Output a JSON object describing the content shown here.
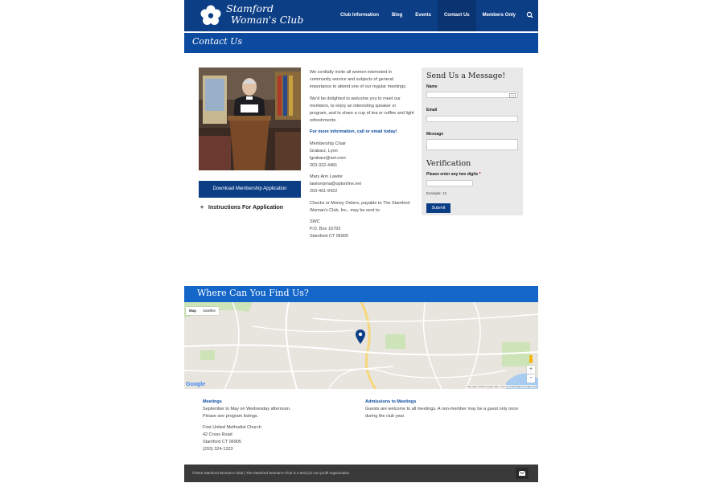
{
  "site": {
    "logo_text_line1": "Stamford",
    "logo_text_line2": "Woman's Club"
  },
  "nav": {
    "items": [
      "Club Information",
      "Blog",
      "Events",
      "Contact Us",
      "Members Only"
    ],
    "active": "Contact Us",
    "search_icon": "search-icon"
  },
  "page_title": "Contact Us",
  "left": {
    "download_button": "Download Membership Application",
    "instructions_label": "Instructions For Application"
  },
  "middle": {
    "intro": "We cordially invite all women interested in community service and subjects of general importance to attend one of our regular meetings.",
    "welcome": "We'd be delighted to welcome you to meet our members, to enjoy an interesting speaker or program, and to share a cup of tea or coffee and light refreshments.",
    "highlight": "For more information, call or email today!",
    "contact1_title": "Membership Chair",
    "contact1_name": "Grabarz, Lynn",
    "contact1_email": "lgrabarz@aol.com",
    "contact1_phone": "203-322-4481",
    "contact2_name": "Mary Ann Lawlor",
    "contact2_email": "lawlorrpma@optonline.net",
    "contact2_phone": "203-461-9422",
    "checks": "Checks or Money Orders, payable to The Stamford Woman's Club, Inc., may be sent to:",
    "addr1": "SWC",
    "addr2": "P.O. Box 16793",
    "addr3": "Stamford CT 06905"
  },
  "form": {
    "title": "Send Us a Message!",
    "name_label": "Name",
    "email_label": "Email",
    "message_label": "Message",
    "verification_title": "Verification",
    "verification_label": "Please enter any two digits",
    "required_mark": "*",
    "example": "Example: 12",
    "submit": "Submit"
  },
  "map_section": {
    "title": "Where Can You Find Us?",
    "map_tab": "Map",
    "satellite_tab": "Satellite",
    "google": "Google",
    "footer_text": "Map data ©2016 Google   500 m   Terms of Use   Report a map error",
    "zoom_in": "+",
    "zoom_out": "−"
  },
  "meetings": {
    "title": "Meetings",
    "line1": "September to May on Wednesday afternoon.",
    "line2": "Please see program listings.",
    "venue1": "First United Methodist Church",
    "venue2": "42 Cross Road",
    "venue3": "Stamford CT 06905",
    "venue4": "(203) 324-1323"
  },
  "admissions": {
    "title": "Admissions to Meetings",
    "text": "Guests are welcome to all meetings. A non-member may be a guest only once during the club year."
  },
  "footer": {
    "text": "©2016 Stamford Woman's Club | The Stamford Woman's Club is a 501(c)3 non-profit organization."
  },
  "colors": {
    "header": "#0c3e86",
    "title_bar": "#0c4aa0",
    "where_bar": "#1467c9",
    "footer": "#3a3a3a"
  }
}
